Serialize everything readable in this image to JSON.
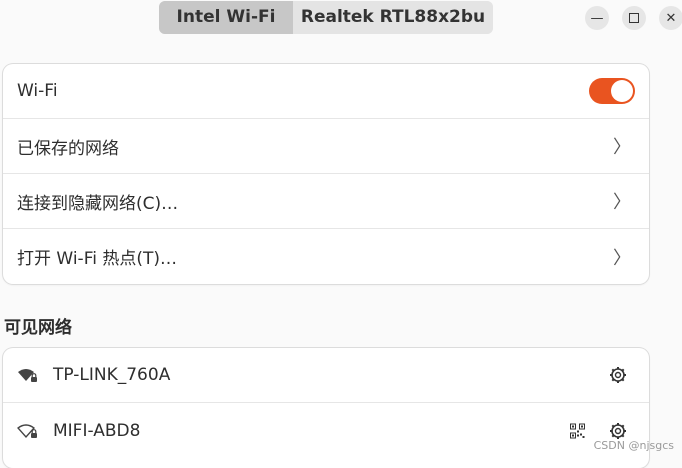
{
  "tabs": [
    {
      "label": "Intel Wi-Fi",
      "active": true
    },
    {
      "label": "Realtek RTL88x2bu",
      "active": false
    }
  ],
  "window_controls": {
    "minimize": "minimize-icon",
    "maximize": "maximize-icon",
    "close": "close-icon"
  },
  "settings": {
    "wifi_label": "Wi-Fi",
    "wifi_enabled": true,
    "saved_networks": "已保存的网络",
    "connect_hidden": "连接到隐藏网络(C)…",
    "hotspot": "打开 Wi-Fi 热点(T)…"
  },
  "visible_networks": {
    "title": "可见网络",
    "items": [
      {
        "ssid": "TP-LINK_760A",
        "has_qr": false
      },
      {
        "ssid": "MIFI-ABD8",
        "has_qr": true
      }
    ]
  },
  "watermark": "CSDN @njsgcs",
  "colors": {
    "accent": "#e95420",
    "background": "#fafafa",
    "card": "#ffffff"
  }
}
